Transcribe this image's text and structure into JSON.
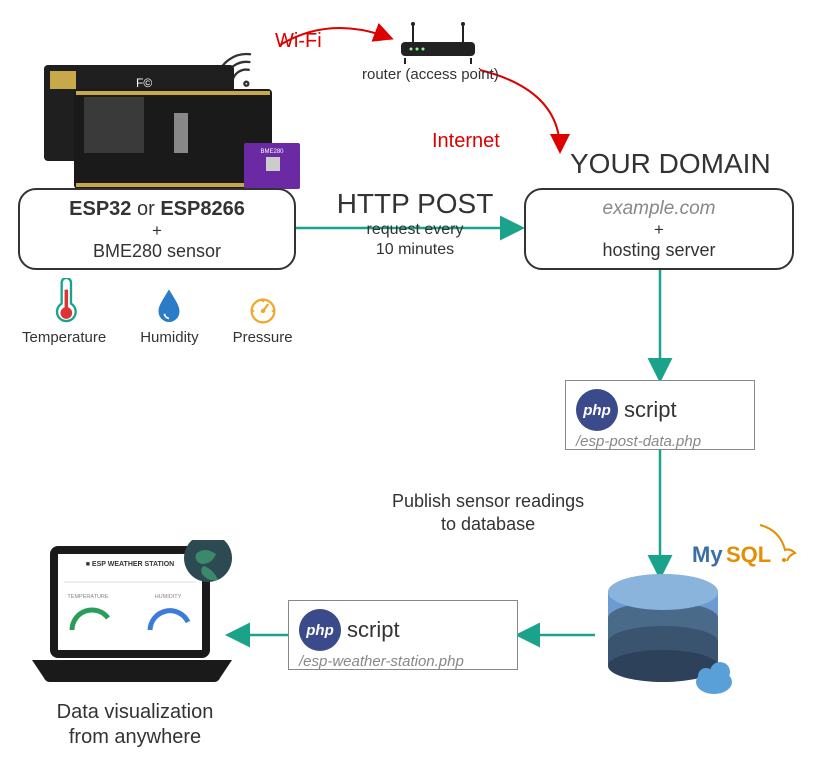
{
  "wifi_label": "Wi-Fi",
  "router_label": "router (access point)",
  "internet_label": "Internet",
  "domain_heading": "YOUR DOMAIN",
  "device_box": {
    "esp32": "ESP32",
    "or": " or ",
    "esp8266": "ESP8266",
    "plus": "+",
    "sensor": "BME280 sensor"
  },
  "http_label": "HTTP POST",
  "http_sub": "request every\n10 minutes",
  "domain_box": {
    "example": "example.com",
    "plus": "+",
    "hosting": "hosting server"
  },
  "sensors": {
    "temperature": "Temperature",
    "humidity": "Humidity",
    "pressure": "Pressure"
  },
  "php1": {
    "label": "script",
    "path": "/esp-post-data.php"
  },
  "publish_label": "Publish sensor readings\nto database",
  "mysql_label": "MySQL",
  "php2": {
    "label": "script",
    "path": "/esp-weather-station.php"
  },
  "viz_label": "Data visualization\nfrom anywhere",
  "laptop": {
    "title": "ESP WEATHER STATION",
    "col1": "TEMPERATURE",
    "col2": "HUMIDITY"
  },
  "purple_chip": "BME280"
}
